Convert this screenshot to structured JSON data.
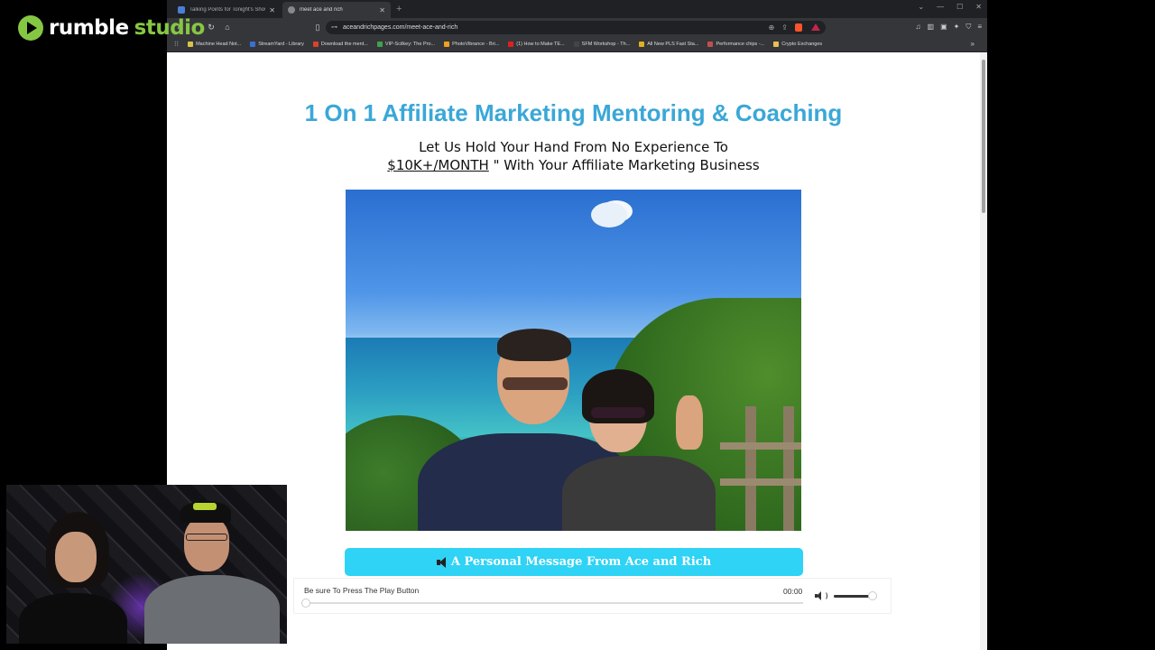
{
  "overlay": {
    "brand_word": "rumble",
    "brand_suffix": "studio",
    "brand_color": "#85c742"
  },
  "browser": {
    "tabs": [
      {
        "title": "Talking Points for Tonight's Show",
        "active": false
      },
      {
        "title": "meet ace and rich",
        "active": true
      }
    ],
    "url": "aceandrichpages.com/meet-ace-and-rich",
    "bookmarks": [
      {
        "label": "Machine Head Not...",
        "color": "#d9c34a"
      },
      {
        "label": "StreamYard - Library",
        "color": "#3b6fd1"
      },
      {
        "label": "Download the ment...",
        "color": "#d9432b"
      },
      {
        "label": "VIP-Scilkey: The Pro...",
        "color": "#3fa34d"
      },
      {
        "label": "PhotoVibrance - Bri...",
        "color": "#f0a020"
      },
      {
        "label": "(1) How to Make TE...",
        "color": "#e02020"
      },
      {
        "label": "SFM Workshop - Th...",
        "color": "#444444"
      },
      {
        "label": "All New PLS Fast Sta...",
        "color": "#e0b020"
      },
      {
        "label": "Performance chips -...",
        "color": "#c0504d"
      },
      {
        "label": "Crypto Exchanges",
        "color": "#e8c050"
      }
    ]
  },
  "page": {
    "title": "1 On 1 Affiliate Marketing Mentoring & Coaching",
    "subtitle_line1": "Let Us Hold Your Hand From No Experience To",
    "subtitle_amount": "$10K+/MONTH",
    "subtitle_rest": " \" With Your Affiliate Marketing Business",
    "title_color": "#3aa7d8",
    "message_button": "A Personal Message From Ace and Rich",
    "message_button_color": "#2ed3f5"
  },
  "player": {
    "label": "Be sure To Press The Play Button",
    "time": "00:00",
    "progress": 0,
    "volume": 0.9
  }
}
